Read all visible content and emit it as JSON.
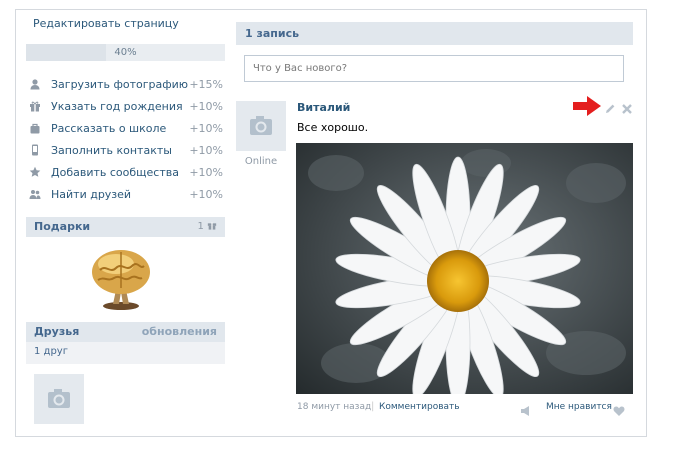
{
  "sidebar": {
    "edit_page": "Редактировать страницу",
    "progress_text": "40%",
    "progress_fraction": 0.4,
    "tasks": [
      {
        "label": "Загрузить фотографию",
        "pct": "+15%",
        "icon": "user-icon"
      },
      {
        "label": "Указать год рождения",
        "pct": "+10%",
        "icon": "gift-icon"
      },
      {
        "label": "Рассказать о школе",
        "pct": "+10%",
        "icon": "bag-icon"
      },
      {
        "label": "Заполнить контакты",
        "pct": "+10%",
        "icon": "phone-icon"
      },
      {
        "label": "Добавить сообщества",
        "pct": "+10%",
        "icon": "star-icon"
      },
      {
        "label": "Найти друзей",
        "pct": "+10%",
        "icon": "people-icon"
      }
    ],
    "gifts": {
      "title": "Подарки",
      "count": "1"
    },
    "friends": {
      "title": "Друзья",
      "updates": "обновления",
      "count_text": "1 друг"
    }
  },
  "wall": {
    "header": "1 запись",
    "input_placeholder": "Что у Вас нового?",
    "post": {
      "author": "Виталий",
      "text": "Все хорошо.",
      "status": "Online",
      "time": "18 минут назад",
      "separator": "|",
      "comment": "Комментировать",
      "like": "Мне нравится"
    }
  },
  "colors": {
    "link": "#2b587a",
    "header_bg": "#e1e7ed",
    "arrow": "#e41e1e"
  }
}
